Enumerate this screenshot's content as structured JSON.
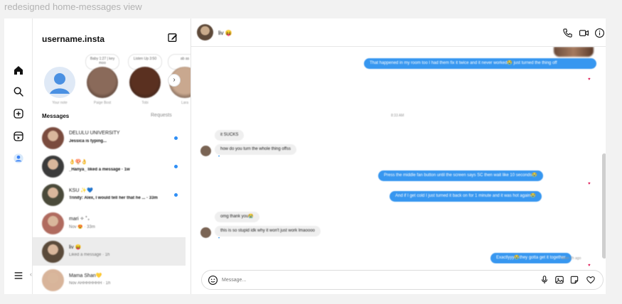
{
  "caption": "redesigned home-messages view",
  "rail": {
    "icons": [
      "home-icon",
      "search-icon",
      "create-icon",
      "reels-icon",
      "profile-icon",
      "menu-icon"
    ]
  },
  "list": {
    "username": "username.insta",
    "notes": [
      {
        "note": "",
        "name": "Your note",
        "color": "#4a90e2"
      },
      {
        "note": "Baby 1:27 | key moo",
        "name": "Paige Bost",
        "color": "#8a6a5a"
      },
      {
        "note": "Listen Up 3:50",
        "name": "Tobi",
        "color": "#5a3020"
      },
      {
        "note": "ab as",
        "name": "Lara",
        "color": "#c9a88f"
      }
    ],
    "section_title": "Messages",
    "requests_label": "Requests",
    "threads": [
      {
        "name": "DELULU UNIVERSITY",
        "preview": "Jessica is typing...",
        "unread": true,
        "color": "#7a4b3e"
      },
      {
        "name": "👌🍄👌",
        "preview": "_Hanya_ liked a message · 1w",
        "unread": true,
        "color": "#3b3b3b"
      },
      {
        "name": "KSU ✨💙",
        "preview": "Trinity: Alex, I would tell her that he ... · 33m",
        "unread": true,
        "color": "#4a4a3a"
      },
      {
        "name": "mari ✧ ˚₊",
        "preview": "Nov 😍 · 33m",
        "unread": false,
        "color": "#b06b5f"
      },
      {
        "name": "liv 😝",
        "preview": "Liked a message · 1h",
        "unread": false,
        "color": "#5a4a3a"
      },
      {
        "name": "Mama Shan💛",
        "preview": "Nov AHHHHHHH · 1h",
        "unread": false,
        "color": "#d8b49a"
      }
    ]
  },
  "chat": {
    "name": "liv 😝",
    "messages": [
      {
        "dir": "out",
        "text": "That happened in my room too I had them fix it twice and it never worked😭 just turned the thing off"
      },
      {
        "dir": "time",
        "text": "8:33 AM"
      },
      {
        "dir": "in",
        "text": "it SUCKS"
      },
      {
        "dir": "in",
        "text": "how do you turn the whole thing offss"
      },
      {
        "dir": "out",
        "text": "Press the middle fan button until the screen says SC then wait like 10 seconds😭"
      },
      {
        "dir": "out",
        "text": "And if I get cold I just turned it back on for 1 minute and it was hot again😭"
      },
      {
        "dir": "in",
        "text": "omg thank you😭"
      },
      {
        "dir": "in",
        "text": "this is so stupid idk why it won't just work lmaoooo"
      },
      {
        "dir": "out",
        "text": "Exactlyyy😭they gotta get it together"
      }
    ],
    "seen": "Seen 2h ago",
    "composer_placeholder": "Message..."
  },
  "colors": {
    "accent": "#3797f0",
    "unread_dot": "#2f8ff5",
    "heart": "#e0245e"
  }
}
